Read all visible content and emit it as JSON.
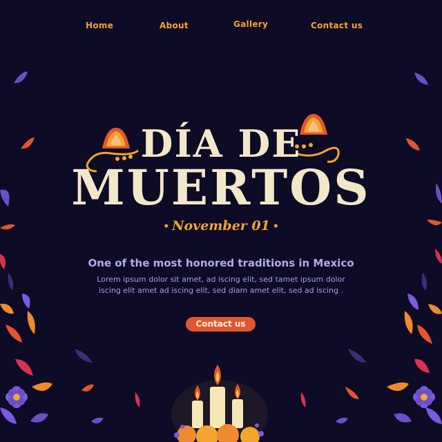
{
  "nav": {
    "items": [
      {
        "label": "Home"
      },
      {
        "label": "About"
      },
      {
        "label": "Gallery"
      },
      {
        "label": "Contact us"
      }
    ]
  },
  "hero": {
    "title_line1": "DÍA DE",
    "title_line2": "MUERTOS",
    "date": "November 01",
    "tagline": "One of the most honored traditions in Mexico",
    "body": "Lorem ipsum dolor sit amet,  ad iscing elit, sed  tamet ipsum dolor iscing elit  amet ad iscing elit, sed diam amet elit, sed ad iscing .",
    "cta_label": "Contact us"
  },
  "colors": {
    "background": "#0d0b26",
    "accent": "#f4a52b",
    "title": "#f3e7c9",
    "cta": "#e3562d",
    "text": "#a99ce6"
  }
}
